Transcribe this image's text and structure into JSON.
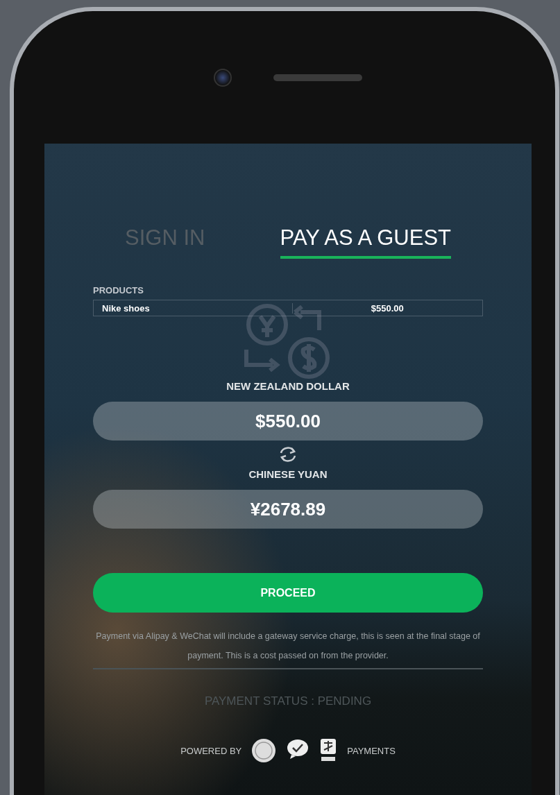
{
  "tabs": [
    {
      "label": "SIGN IN",
      "selected": false
    },
    {
      "label": "PAY AS A GUEST",
      "selected": true
    }
  ],
  "products": {
    "heading": "PRODUCTS",
    "rows": [
      {
        "name": "Nike shoes",
        "price": "$550.00"
      }
    ]
  },
  "from": {
    "label": "NEW ZEALAND DOLLAR",
    "value": "$550.00"
  },
  "to": {
    "label": "CHINESE YUAN",
    "value": "¥2678.89"
  },
  "proceed": "PROCEED",
  "note": "Payment via Alipay & WeChat will include a gateway service charge, this is seen at the final stage of payment. This is a cost passed on from the provider.",
  "status": "PAYMENT STATUS : PENDING",
  "powered_by": "POWERED BY",
  "payments": "PAYMENTS"
}
